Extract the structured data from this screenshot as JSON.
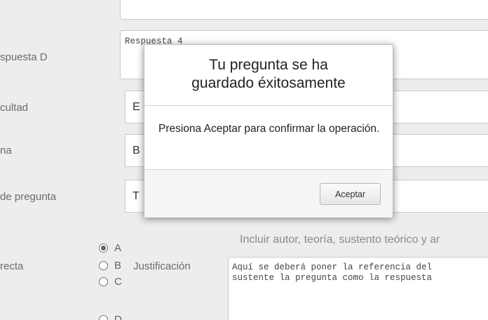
{
  "labels": {
    "respuesta_d": "spuesta D",
    "dificultad": "cultad",
    "tema": "na",
    "tipo": "de pregunta",
    "correcta": "recta",
    "justificacion": "Justificación"
  },
  "fields": {
    "respuesta_d_value": "Respuesta 4",
    "dificultad_value": "E",
    "tema_value": "B",
    "tipo_value": "T"
  },
  "radios": [
    {
      "label": "A",
      "checked": true
    },
    {
      "label": "B",
      "checked": false
    },
    {
      "label": "C",
      "checked": false
    },
    {
      "label": "D",
      "checked": false
    }
  ],
  "justificacion": {
    "hint": "Incluir autor, teoría, sustento teórico y ar",
    "text_line1": "Aquí se deberá poner la referencia del",
    "text_line2": "sustente la pregunta como la respuesta"
  },
  "modal": {
    "title_line1": "Tu pregunta se ha",
    "title_line2": "guardado éxitosamente",
    "body": "Presiona Aceptar para confirmar la operación.",
    "button": "Aceptar"
  }
}
